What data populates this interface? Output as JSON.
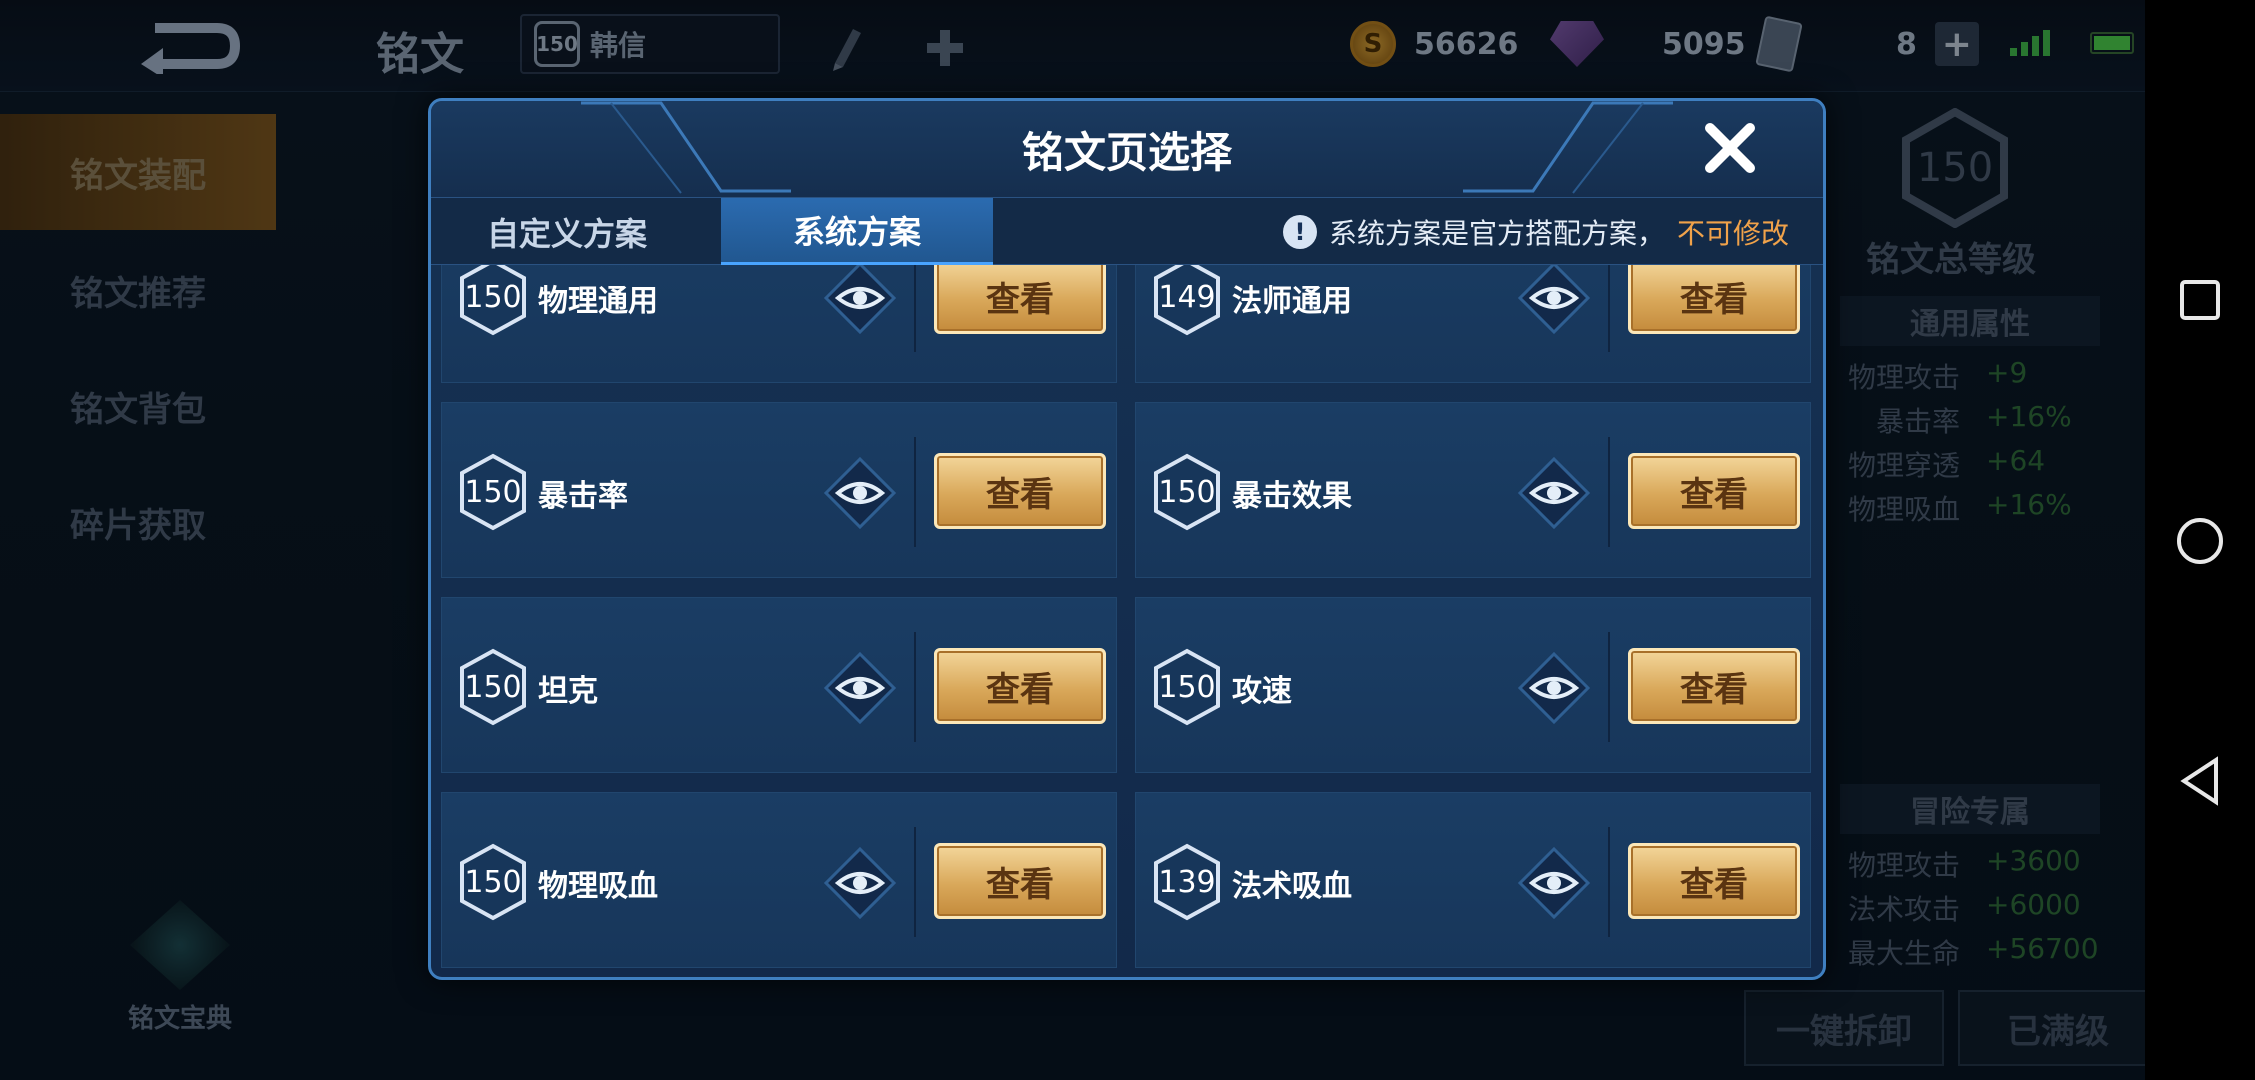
{
  "topbar": {
    "page_name": "铭文",
    "hero_level": "150",
    "hero_name": "韩信",
    "gold": "56626",
    "gems": "5095",
    "cards": "8",
    "coin_symbol": "S"
  },
  "sidebar": {
    "items": [
      {
        "label": "铭文装配"
      },
      {
        "label": "铭文推荐"
      },
      {
        "label": "铭文背包"
      },
      {
        "label": "碎片获取"
      }
    ],
    "codex_label": "铭文宝典"
  },
  "right_panel": {
    "total_level": "150",
    "total_label": "铭文总等级",
    "general_title": "通用属性",
    "general_stats": [
      {
        "k": "物理攻击",
        "v": "+9"
      },
      {
        "k": "暴击率",
        "v": "+16%"
      },
      {
        "k": "物理穿透",
        "v": "+64"
      },
      {
        "k": "物理吸血",
        "v": "+16%"
      }
    ],
    "adventure_title": "冒险专属",
    "adventure_stats": [
      {
        "k": "物理攻击",
        "v": "+3600"
      },
      {
        "k": "法术攻击",
        "v": "+6000"
      },
      {
        "k": "最大生命",
        "v": "+56700"
      }
    ],
    "unequip_label": "一键拆卸",
    "maxed_label": "已满级"
  },
  "modal": {
    "title": "铭文页选择",
    "tabs": [
      {
        "label": "自定义方案"
      },
      {
        "label": "系统方案"
      }
    ],
    "notice_text": "系统方案是官方搭配方案，",
    "notice_warn": "不可修改",
    "view_label": "查看",
    "pages": [
      {
        "level": "150",
        "name": "物理通用"
      },
      {
        "level": "149",
        "name": "法师通用"
      },
      {
        "level": "150",
        "name": "暴击率"
      },
      {
        "level": "150",
        "name": "暴击效果"
      },
      {
        "level": "150",
        "name": "坦克"
      },
      {
        "level": "150",
        "name": "攻速"
      },
      {
        "level": "150",
        "name": "物理吸血"
      },
      {
        "level": "139",
        "name": "法术吸血"
      }
    ]
  },
  "colors": {
    "accent_gold": "#d9a85a",
    "warn_orange": "#f0a24a",
    "modal_blue": "#163253"
  }
}
